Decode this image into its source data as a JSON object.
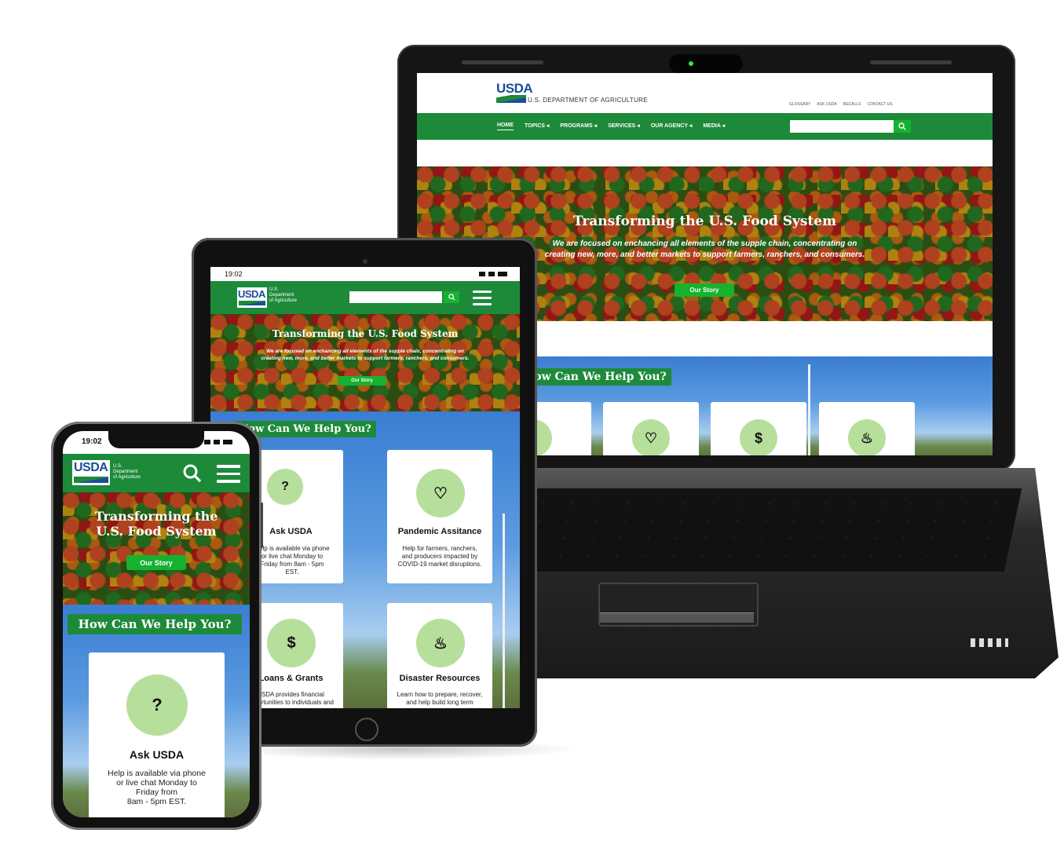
{
  "laptop": {
    "agency_title": "U.S. DEPARTMENT OF AGRICULTURE",
    "logo": "USDA",
    "util_links": [
      "GLOSSARY",
      "ASK USDA",
      "RECALLS",
      "CONTACT US"
    ],
    "nav": [
      "HOME",
      "TOPICS ◂",
      "PROGRAMS ◂",
      "SERVICES ◂",
      "OUR AGENCY ◂",
      "MEDIA ◂"
    ],
    "hero_title": "Transforming the U.S. Food System",
    "hero_text_1": "We are focused on enchancing all elements of the supple chain, concentrating on",
    "hero_text_2": "creating new, more, and better markets to support farmers, ranchers, and consumers.",
    "hero_button": "Our Story",
    "help_heading": "How Can We Help You?"
  },
  "tablet": {
    "time": "19:02",
    "logo": "USDA",
    "logo_sub_1": "U.S.",
    "logo_sub_2": "Department",
    "logo_sub_3": "of Agriculture",
    "hero_title": "Transforming the U.S. Food System",
    "hero_text_1": "We are focused on enchancing all elements of the supple chain, concentrating on",
    "hero_text_2": "creating new, more, and better markets to support farmers, ranchers, and consumers.",
    "hero_button": "Our Story",
    "help_heading": "How Can We Help You?",
    "cards": [
      {
        "title": "Ask USDA",
        "text": "Help is available via phone or live chat Monday to Friday from 8am - 5pm EST."
      },
      {
        "title": "Pandemic Assitance",
        "text": "Help for farmers, ranchers, and producers impacted by COVID-19 market disruptions."
      },
      {
        "title": "Loans & Grants",
        "text": "USDA provides financial opportunities to individuals and"
      },
      {
        "title": "Disaster Resources",
        "text": "Learn how to prepare, recover, and help build long term"
      }
    ]
  },
  "phone": {
    "time": "19:02",
    "logo": "USDA",
    "logo_sub_1": "U.S.",
    "logo_sub_2": "Department",
    "logo_sub_3": "of Agriculture",
    "hero_title_1": "Transforming the",
    "hero_title_2": "U.S. Food System",
    "hero_button": "Our Story",
    "help_heading": "How Can We Help You?",
    "card_title": "Ask USDA",
    "card_text_1": "Help is available via phone",
    "card_text_2": "or live chat Monday to",
    "card_text_3": "Friday from",
    "card_text_4": "8am - 5pm EST."
  },
  "icons": [
    "question-bubble-icon",
    "heart-hands-icon",
    "money-hand-icon",
    "fire-icon",
    "search-icon",
    "menu-icon"
  ],
  "colors": {
    "usda_green": "#1d8a3a",
    "button_green": "#16b22f",
    "icon_bg": "#b7df9c",
    "usda_blue": "#1b4d9b"
  }
}
